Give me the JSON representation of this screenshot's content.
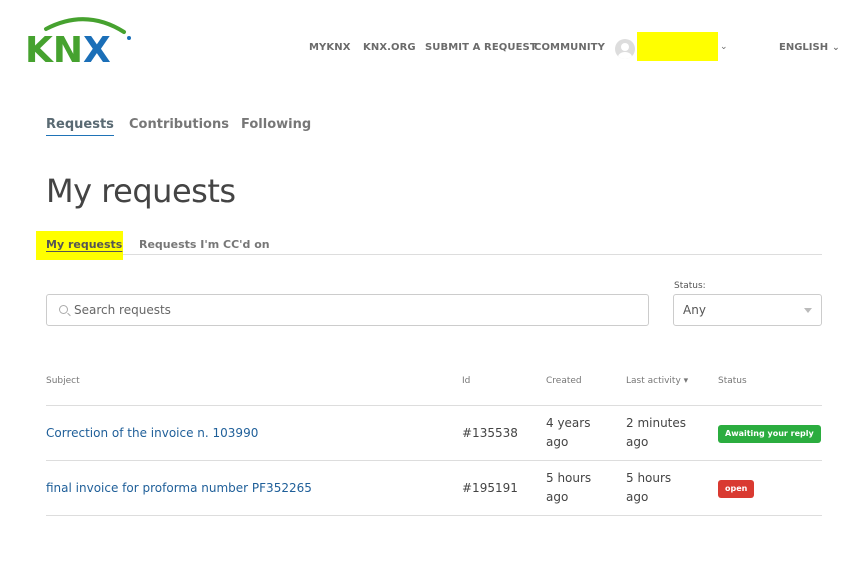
{
  "brand": {
    "logo_text": "KNX",
    "colors": {
      "green": "#46a22f",
      "blue": "#1b6fb8",
      "highlight": "#ffff00"
    }
  },
  "nav": {
    "items": [
      {
        "label": "MYKNX"
      },
      {
        "label": "KNX.ORG"
      },
      {
        "label": "SUBMIT A REQUEST"
      },
      {
        "label": "COMMUNITY"
      }
    ],
    "user_menu_icon": "chevron-down-icon",
    "language": "ENGLISH"
  },
  "profile_tabs": [
    {
      "label": "Requests"
    },
    {
      "label": "Contributions"
    },
    {
      "label": "Following"
    }
  ],
  "page_title": "My requests",
  "sub_tabs": [
    {
      "label": "My requests"
    },
    {
      "label": "Requests I'm CC'd on"
    }
  ],
  "search": {
    "placeholder": "Search requests"
  },
  "status_filter": {
    "label": "Status:",
    "value": "Any"
  },
  "table": {
    "headers": {
      "subject": "Subject",
      "id": "Id",
      "created": "Created",
      "last_activity": "Last activity ▾",
      "status": "Status"
    },
    "rows": [
      {
        "subject": "Correction of the invoice n. 103990",
        "id": "#135538",
        "created_l1": "4 years",
        "created_l2": "ago",
        "last_l1": "2 minutes",
        "last_l2": "ago",
        "status": "Awaiting your reply",
        "status_color": "#2bad3f"
      },
      {
        "subject": "final invoice for proforma number PF352265",
        "id": "#195191",
        "created_l1": "5 hours",
        "created_l2": "ago",
        "last_l1": "5 hours",
        "last_l2": "ago",
        "status": "open",
        "status_color": "#d93a31"
      }
    ]
  }
}
